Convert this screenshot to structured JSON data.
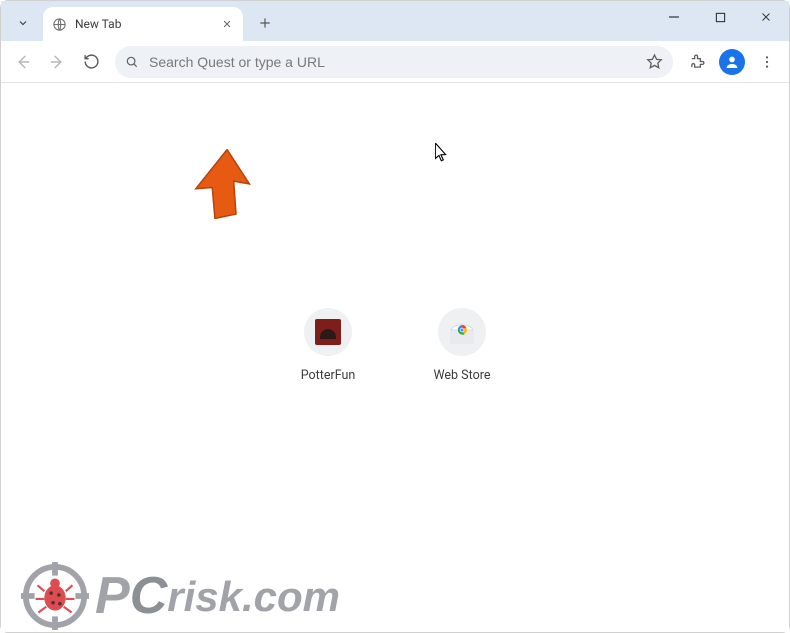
{
  "window": {
    "tab_title": "New Tab"
  },
  "omnibox": {
    "placeholder": "Search Quest or type a URL",
    "value": ""
  },
  "shortcuts": [
    {
      "label": "PotterFun"
    },
    {
      "label": "Web Store"
    }
  ],
  "watermark": {
    "text_p": "P",
    "text_c": "C",
    "text_rest": "risk.com"
  }
}
